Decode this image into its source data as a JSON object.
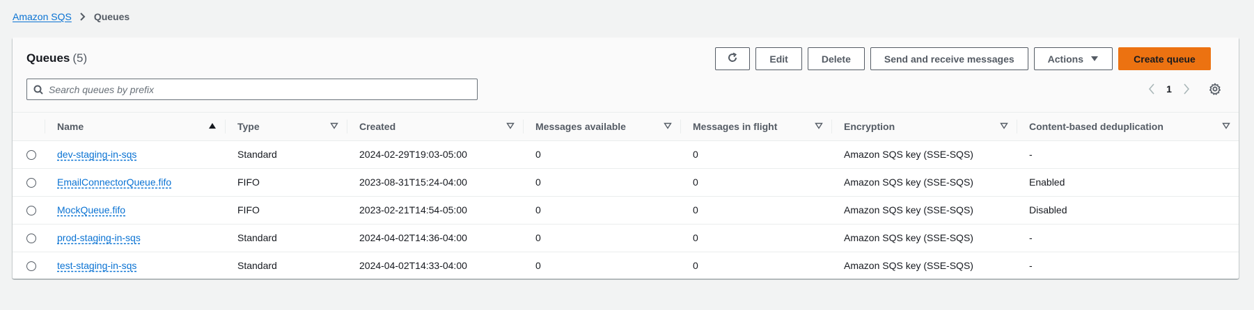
{
  "breadcrumb": {
    "root": "Amazon SQS",
    "current": "Queues"
  },
  "header": {
    "title": "Queues",
    "count": "(5)"
  },
  "toolbar": {
    "refresh_icon": "refresh-icon",
    "edit": "Edit",
    "delete": "Delete",
    "send_receive": "Send and receive messages",
    "actions": "Actions",
    "create": "Create queue"
  },
  "search": {
    "placeholder": "Search queues by prefix",
    "value": ""
  },
  "pagination": {
    "current_page": "1"
  },
  "table": {
    "columns": [
      "Name",
      "Type",
      "Created",
      "Messages available",
      "Messages in flight",
      "Encryption",
      "Content-based deduplication"
    ],
    "sorted_column": "Name",
    "sort_direction": "ascending",
    "rows": [
      {
        "name": "dev-staging-in-sqs",
        "type": "Standard",
        "created": "2024-02-29T19:03-05:00",
        "available": "0",
        "in_flight": "0",
        "encryption": "Amazon SQS key (SSE-SQS)",
        "dedup": "-"
      },
      {
        "name": "EmailConnectorQueue.fifo",
        "type": "FIFO",
        "created": "2023-08-31T15:24-04:00",
        "available": "0",
        "in_flight": "0",
        "encryption": "Amazon SQS key (SSE-SQS)",
        "dedup": "Enabled"
      },
      {
        "name": "MockQueue.fifo",
        "type": "FIFO",
        "created": "2023-02-21T14:54-05:00",
        "available": "0",
        "in_flight": "0",
        "encryption": "Amazon SQS key (SSE-SQS)",
        "dedup": "Disabled"
      },
      {
        "name": "prod-staging-in-sqs",
        "type": "Standard",
        "created": "2024-04-02T14:36-04:00",
        "available": "0",
        "in_flight": "0",
        "encryption": "Amazon SQS key (SSE-SQS)",
        "dedup": "-"
      },
      {
        "name": "test-staging-in-sqs",
        "type": "Standard",
        "created": "2024-04-02T14:33-04:00",
        "available": "0",
        "in_flight": "0",
        "encryption": "Amazon SQS key (SSE-SQS)",
        "dedup": "-"
      }
    ]
  },
  "colors": {
    "link": "#0972d3",
    "primary": "#ec7211",
    "page_bg": "#f2f3f3"
  }
}
